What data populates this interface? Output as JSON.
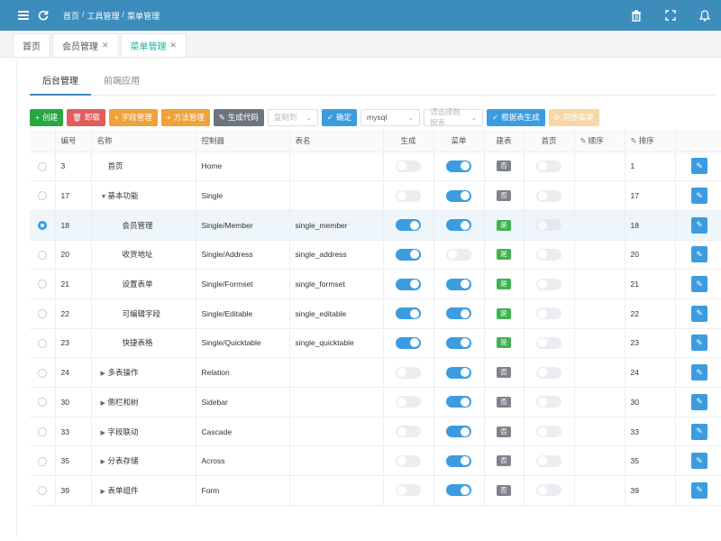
{
  "breadcrumb": [
    "首页",
    "工具管理",
    "菜单管理"
  ],
  "page_tabs": [
    {
      "label": "首页",
      "closable": false,
      "active": false
    },
    {
      "label": "会员管理",
      "closable": true,
      "active": false
    },
    {
      "label": "菜单管理",
      "closable": true,
      "active": true
    }
  ],
  "sub_tabs": [
    "后台管理",
    "前端应用"
  ],
  "toolbar": {
    "create": "创建",
    "delete": "卸载",
    "fields": "字段管理",
    "methods": "方法管理",
    "generate_code": "生成代码",
    "copy_to": "复制到",
    "confirm": "确定",
    "db_select": "mysql",
    "table_select_placeholder": "请选择数据表",
    "generate_by_table": "根据表生成",
    "sync_menu": "同步菜单"
  },
  "table": {
    "columns": [
      "编号",
      "名称",
      "控制器",
      "表名",
      "生成",
      "菜单",
      "建表",
      "首页",
      "顺序",
      "排序"
    ],
    "rows": [
      {
        "id": "3",
        "name": "首页",
        "indent": 1,
        "caret": "",
        "controller": "Home",
        "table": "",
        "gen": false,
        "menu": true,
        "built": "否",
        "home": false,
        "sort": "1",
        "selected": false
      },
      {
        "id": "17",
        "name": "基本功能",
        "indent": 1,
        "caret": "▼",
        "controller": "Single",
        "table": "",
        "gen": false,
        "menu": true,
        "built": "否",
        "home": false,
        "sort": "17",
        "selected": false
      },
      {
        "id": "18",
        "name": "会员管理",
        "indent": 2,
        "caret": "",
        "controller": "Single/Member",
        "table": "single_member",
        "gen": true,
        "menu": true,
        "built": "是",
        "home": false,
        "sort": "18",
        "selected": true
      },
      {
        "id": "20",
        "name": "收货地址",
        "indent": 2,
        "caret": "",
        "controller": "Single/Address",
        "table": "single_address",
        "gen": true,
        "menu": false,
        "built": "是",
        "home": false,
        "sort": "20",
        "selected": false
      },
      {
        "id": "21",
        "name": "设置表单",
        "indent": 2,
        "caret": "",
        "controller": "Single/Formset",
        "table": "single_formset",
        "gen": true,
        "menu": true,
        "built": "是",
        "home": false,
        "sort": "21",
        "selected": false
      },
      {
        "id": "22",
        "name": "可编辑字段",
        "indent": 2,
        "caret": "",
        "controller": "Single/Editable",
        "table": "single_editable",
        "gen": true,
        "menu": true,
        "built": "是",
        "home": false,
        "sort": "22",
        "selected": false
      },
      {
        "id": "23",
        "name": "快捷表格",
        "indent": 2,
        "caret": "",
        "controller": "Single/Quicktable",
        "table": "single_quicktable",
        "gen": true,
        "menu": true,
        "built": "是",
        "home": false,
        "sort": "23",
        "selected": false
      },
      {
        "id": "24",
        "name": "多表操作",
        "indent": 1,
        "caret": "▶",
        "controller": "Relation",
        "table": "",
        "gen": false,
        "menu": true,
        "built": "否",
        "home": false,
        "sort": "24",
        "selected": false
      },
      {
        "id": "30",
        "name": "侧栏和树",
        "indent": 1,
        "caret": "▶",
        "controller": "Sidebar",
        "table": "",
        "gen": false,
        "menu": true,
        "built": "否",
        "home": false,
        "sort": "30",
        "selected": false
      },
      {
        "id": "33",
        "name": "字段联动",
        "indent": 1,
        "caret": "▶",
        "controller": "Cascade",
        "table": "",
        "gen": false,
        "menu": true,
        "built": "否",
        "home": false,
        "sort": "33",
        "selected": false
      },
      {
        "id": "35",
        "name": "分表存储",
        "indent": 1,
        "caret": "▶",
        "controller": "Across",
        "table": "",
        "gen": false,
        "menu": true,
        "built": "否",
        "home": false,
        "sort": "35",
        "selected": false
      },
      {
        "id": "39",
        "name": "表单组件",
        "indent": 1,
        "caret": "▶",
        "controller": "Form",
        "table": "",
        "gen": false,
        "menu": true,
        "built": "否",
        "home": false,
        "sort": "39",
        "selected": false
      }
    ]
  },
  "colors": {
    "topbar": "#3c8dbc",
    "accent": "#3c9ce0",
    "active_tab": "#1fb19e"
  }
}
